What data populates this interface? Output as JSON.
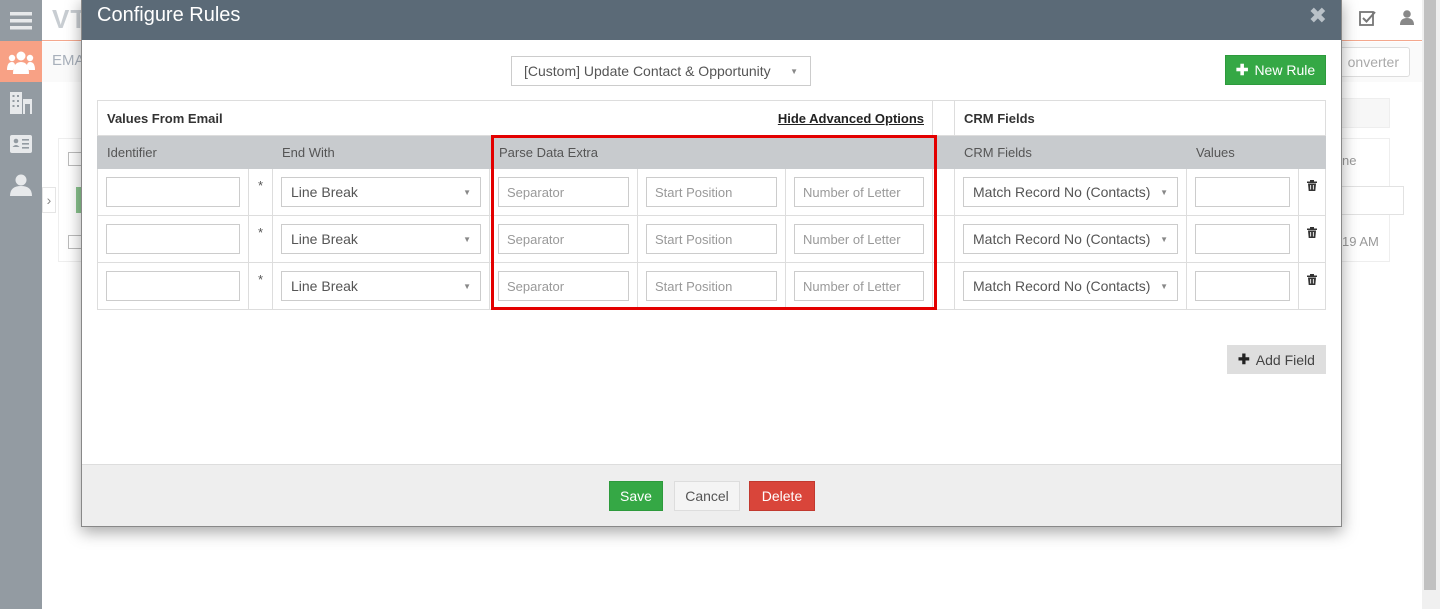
{
  "background": {
    "logo_text": "VT",
    "subheader_label": "EMAI",
    "converter_label": "onverter",
    "time_text": "19 AM",
    "column_fragment": "ne"
  },
  "sidebar": {
    "items": [
      {
        "icon": "menu-icon",
        "glyph": "☰",
        "active": false
      },
      {
        "icon": "contacts-group-icon",
        "glyph": "👥",
        "active": true
      },
      {
        "icon": "building-icon",
        "glyph": "▦",
        "active": false
      },
      {
        "icon": "id-card-icon",
        "glyph": "▤",
        "active": false
      },
      {
        "icon": "user-icon",
        "glyph": "●",
        "active": false
      }
    ]
  },
  "topbar_icons": [
    {
      "icon": "checkbox-tasks-icon",
      "glyph": "☑"
    },
    {
      "icon": "user-profile-icon",
      "glyph": "👤"
    }
  ],
  "modal": {
    "title": "Configure Rules",
    "close_glyph": "✖",
    "rule_select": {
      "value": "[Custom] Update Contact & Opportunity"
    },
    "new_rule_label": "New Rule",
    "groups": {
      "values_from_email": "Values From Email",
      "hide_advanced": "Hide Advanced Options",
      "crm_fields": "CRM Fields"
    },
    "columns": {
      "identifier": "Identifier",
      "end_with": "End With",
      "parse_data_extra": "Parse Data Extra",
      "crm_fields": "CRM Fields",
      "values": "Values"
    },
    "rows": [
      {
        "identifier": "",
        "required_mark": "*",
        "end_with": "Line Break",
        "separator_placeholder": "Separator",
        "start_position_placeholder": "Start Position",
        "number_of_letter_placeholder": "Number of Letter",
        "crm_field": "Match Record No (Contacts)",
        "value": ""
      },
      {
        "identifier": "",
        "required_mark": "*",
        "end_with": "Line Break",
        "separator_placeholder": "Separator",
        "start_position_placeholder": "Start Position",
        "number_of_letter_placeholder": "Number of Letter",
        "crm_field": "Match Record No (Contacts)",
        "value": ""
      },
      {
        "identifier": "",
        "required_mark": "*",
        "end_with": "Line Break",
        "separator_placeholder": "Separator",
        "start_position_placeholder": "Start Position",
        "number_of_letter_placeholder": "Number of Letter",
        "crm_field": "Match Record No (Contacts)",
        "value": ""
      }
    ],
    "add_field_label": "Add Field",
    "footer": {
      "save_label": "Save",
      "cancel_label": "Cancel",
      "delete_label": "Delete"
    }
  },
  "colors": {
    "header_bg": "#5b6a77",
    "success": "#35a845",
    "danger": "#d9453a",
    "highlight": "#e30000",
    "sidebar_active": "#f8a185"
  }
}
